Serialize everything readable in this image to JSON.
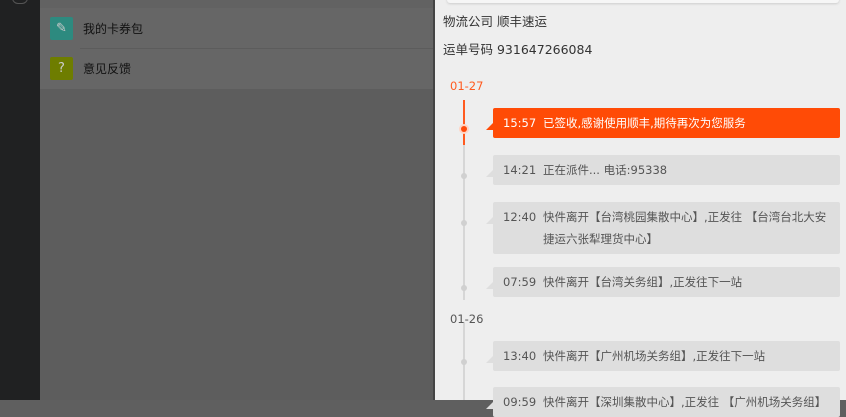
{
  "menu": [
    {
      "label": "我的卡券包",
      "icon": "ticket-icon",
      "color": "#2d8a7f"
    },
    {
      "label": "意见反馈",
      "icon": "question-icon",
      "color": "#6e7d00"
    }
  ],
  "shipment": {
    "company_label": "物流公司 顺丰速运",
    "tracking_label": "运单号码 931647266084"
  },
  "timeline": [
    {
      "date": "01-27",
      "events": [
        {
          "time": "15:57",
          "text": "已签收,感谢使用顺丰,期待再次为您服务",
          "active": true
        },
        {
          "time": "14:21",
          "text": "正在派件... 电话:95338"
        },
        {
          "time": "12:40",
          "text": "快件离开【台湾桃园集散中心】,正发往 【台湾台北大安捷运六张犁理货中心】"
        },
        {
          "time": "07:59",
          "text": "快件离开【台湾关务组】,正发往下一站"
        }
      ]
    },
    {
      "date": "01-26",
      "events": [
        {
          "time": "13:40",
          "text": "快件离开【广州机场关务组】,正发往下一站"
        },
        {
          "time": "09:59",
          "text": "快件离开【深圳集散中心】,正发往 【广州机场关务组】"
        }
      ]
    }
  ],
  "colors": {
    "accent": "#ff4b06"
  }
}
